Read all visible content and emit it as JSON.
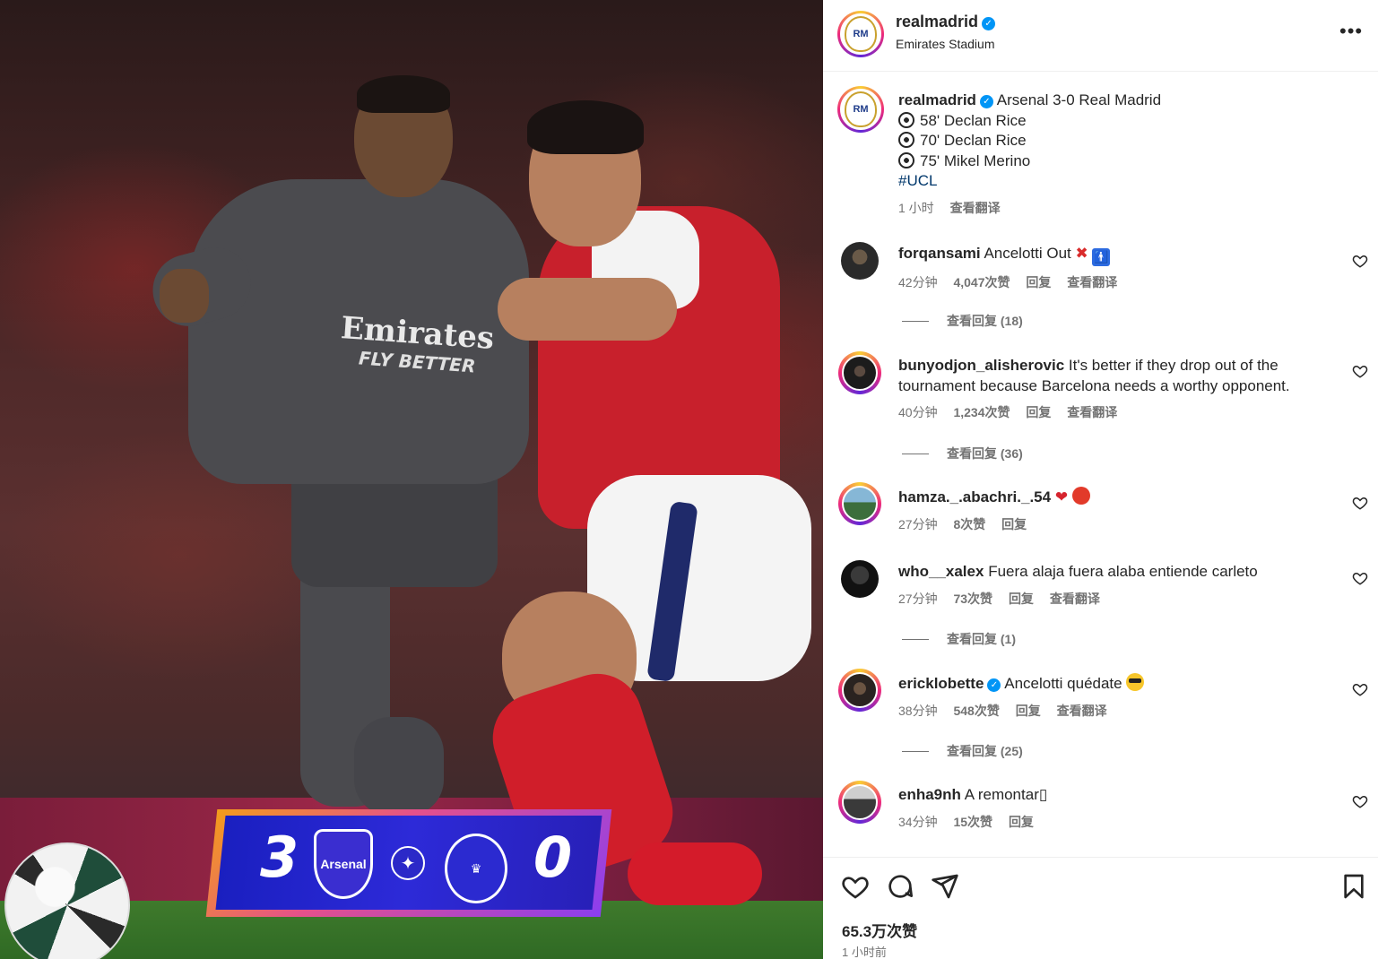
{
  "photo": {
    "shirt_line1": "Emirates",
    "shirt_line2": "FLY BETTER",
    "score_home": "3",
    "score_away": "0",
    "home_crest_text": "Arsenal"
  },
  "header": {
    "username": "realmadrid",
    "location": "Emirates Stadium"
  },
  "caption": {
    "username": "realmadrid",
    "title": "Arsenal 3-0 Real Madrid",
    "goals": [
      "58' Declan Rice",
      "70' Declan Rice",
      "75' Mikel Merino"
    ],
    "hashtag": "#UCL",
    "time": "1 小时",
    "translate": "查看翻译"
  },
  "comments": [
    {
      "username": "forqansami",
      "text": "Ancelotti Out",
      "time": "42分钟",
      "likes": "4,047次赞",
      "reply": "回复",
      "translate": "查看翻译",
      "view_replies": "查看回复 (18)"
    },
    {
      "username": "bunyodjon_alisherovic",
      "text": "It's better if they drop out of the tournament because Barcelona needs a worthy opponent.",
      "time": "40分钟",
      "likes": "1,234次赞",
      "reply": "回复",
      "translate": "查看翻译",
      "view_replies": "查看回复 (36)"
    },
    {
      "username": "hamza._.abachri._.54",
      "text": "",
      "time": "27分钟",
      "likes": "8次赞",
      "reply": "回复"
    },
    {
      "username": "who__xalex",
      "text": "Fuera alaja fuera alaba entiende carleto",
      "time": "27分钟",
      "likes": "73次赞",
      "reply": "回复",
      "translate": "查看翻译",
      "view_replies": "查看回复 (1)"
    },
    {
      "username": "ericklobette",
      "text": "Ancelotti quédate",
      "time": "38分钟",
      "likes": "548次赞",
      "reply": "回复",
      "translate": "查看翻译",
      "view_replies": "查看回复 (25)"
    },
    {
      "username": "enha9nh",
      "text": "A remontar▯",
      "time": "34分钟",
      "likes": "15次赞",
      "reply": "回复"
    }
  ],
  "footer": {
    "likes": "65.3万次赞",
    "time": "1 小时前"
  },
  "icons": {
    "like": "heart-icon",
    "comment": "comment-icon",
    "share": "share-icon",
    "save": "bookmark-icon",
    "more": "more-icon"
  },
  "colors": {
    "verified": "#0095f6",
    "meta_text": "#737373",
    "hashtag": "#00376b"
  }
}
